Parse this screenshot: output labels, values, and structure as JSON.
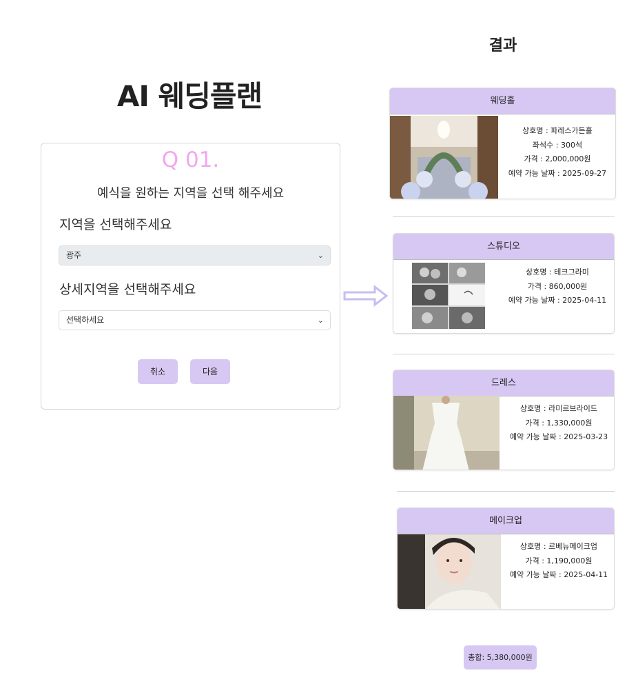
{
  "app": {
    "title": "AI 웨딩플랜"
  },
  "question": {
    "number": "Q 01.",
    "text": "예식을 원하는 지역을 선택 해주세요",
    "region_label": "지역을 선택해주세요",
    "region_value": "광주",
    "detail_label": "상세지역을 선택해주세요",
    "detail_value": "선택하세요",
    "cancel_label": "취소",
    "next_label": "다음"
  },
  "results": {
    "title": "결과",
    "cards": [
      {
        "header": "웨딩홀",
        "photo": "wedding-hall-photo",
        "lines": [
          "상호명 : 파레스가든홀",
          "좌석수 : 300석",
          "가격 : 2,000,000원",
          "예약 가능 날짜 : 2025-09-27"
        ]
      },
      {
        "header": "스튜디오",
        "photo": "studio-photo",
        "lines": [
          "상호명 : 테크그라미",
          "가격 : 860,000원",
          "예약 가능 날짜 : 2025-04-11"
        ]
      },
      {
        "header": "드레스",
        "photo": "dress-photo",
        "lines": [
          "상호명 : 라미르브라이드",
          "가격 : 1,330,000원",
          "예약 가능 날짜 : 2025-03-23"
        ]
      },
      {
        "header": "메이크업",
        "photo": "makeup-photo",
        "lines": [
          "상호명 : 르베뉴메이크업",
          "가격 : 1,190,000원",
          "예약 가능 날짜 : 2025-04-11"
        ]
      }
    ],
    "total": "총합: 5,380,000원"
  },
  "colors": {
    "accent": "#d7c8f3",
    "question_number": "#f3a6ee",
    "arrow": "#c7bdf0"
  }
}
